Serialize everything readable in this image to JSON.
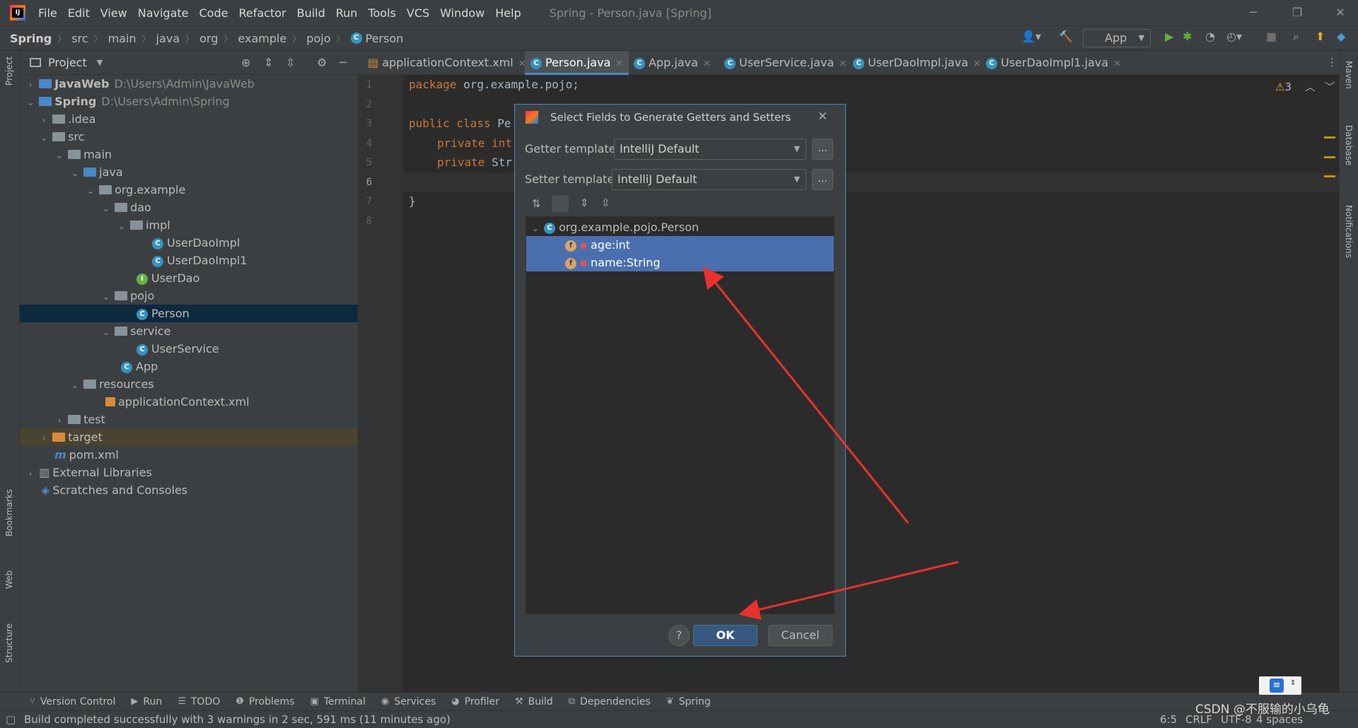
{
  "menubar": {
    "items": [
      "File",
      "Edit",
      "View",
      "Navigate",
      "Code",
      "Refactor",
      "Build",
      "Run",
      "Tools",
      "VCS",
      "Window",
      "Help"
    ],
    "title": "Spring - Person.java [Spring]"
  },
  "navbar": {
    "breadcrumbs": [
      "Spring",
      "src",
      "main",
      "java",
      "org",
      "example",
      "pojo",
      "Person"
    ],
    "run_config": "App"
  },
  "project_panel": {
    "header": "Project",
    "tree": [
      {
        "label": "JavaWeb",
        "hint": "D:\\Users\\Admin\\JavaWeb"
      },
      {
        "label": "Spring",
        "hint": "D:\\Users\\Admin\\Spring"
      },
      {
        "label": ".idea"
      },
      {
        "label": "src"
      },
      {
        "label": "main"
      },
      {
        "label": "java"
      },
      {
        "label": "org.example"
      },
      {
        "label": "dao"
      },
      {
        "label": "impl"
      },
      {
        "label": "UserDaoImpl"
      },
      {
        "label": "UserDaoImpl1"
      },
      {
        "label": "UserDao"
      },
      {
        "label": "pojo"
      },
      {
        "label": "Person"
      },
      {
        "label": "service"
      },
      {
        "label": "UserService"
      },
      {
        "label": "App"
      },
      {
        "label": "resources"
      },
      {
        "label": "applicationContext.xml"
      },
      {
        "label": "test"
      },
      {
        "label": "target"
      },
      {
        "label": "pom.xml"
      },
      {
        "label": "External Libraries"
      },
      {
        "label": "Scratches and Consoles"
      }
    ]
  },
  "tabs": [
    "applicationContext.xml",
    "Person.java",
    "App.java",
    "UserService.java",
    "UserDaoImpl.java",
    "UserDaoImpl1.java"
  ],
  "editor": {
    "line_numbers": [
      "1",
      "2",
      "3",
      "4",
      "5",
      "6",
      "7",
      "8"
    ],
    "lines": {
      "l1_kw": "package",
      "l1_rest": " org.example.pojo;",
      "l3_kw": "public class",
      "l3_rest": " Pe",
      "l4_kw": "private int",
      "l5_kw": "private",
      "l5_rest": " Str",
      "l7": "}"
    },
    "warnings": "3"
  },
  "dialog": {
    "title": "Select Fields to Generate Getters and Setters",
    "getter_label": "Getter template:",
    "getter_value": "IntelliJ Default",
    "setter_label": "Setter template:",
    "setter_value": "IntelliJ Default",
    "ellipsis": "...",
    "class_node": "org.example.pojo.Person",
    "fields": [
      "age:int",
      "name:String"
    ],
    "help": "?",
    "ok": "OK",
    "cancel": "Cancel"
  },
  "side_tools": {
    "left": [
      "Project",
      "Bookmarks",
      "Web",
      "Structure"
    ],
    "right": [
      "Maven",
      "Database",
      "Notifications"
    ]
  },
  "bottom_tools": [
    "Version Control",
    "Run",
    "TODO",
    "Problems",
    "Terminal",
    "Services",
    "Profiler",
    "Build",
    "Dependencies",
    "Spring"
  ],
  "status": {
    "message": "Build completed successfully with 3 warnings in 2 sec, 591 ms (11 minutes ago)",
    "position": "6:5",
    "line_sep": "CRLF",
    "encoding": "UTF-8",
    "indent": "4 spaces",
    "watermark": "CSDN @不服输的小乌龟"
  },
  "colors": {
    "accent": "#4a88c7",
    "selection": "#4b6eaf",
    "arrow": "#e8322f"
  }
}
